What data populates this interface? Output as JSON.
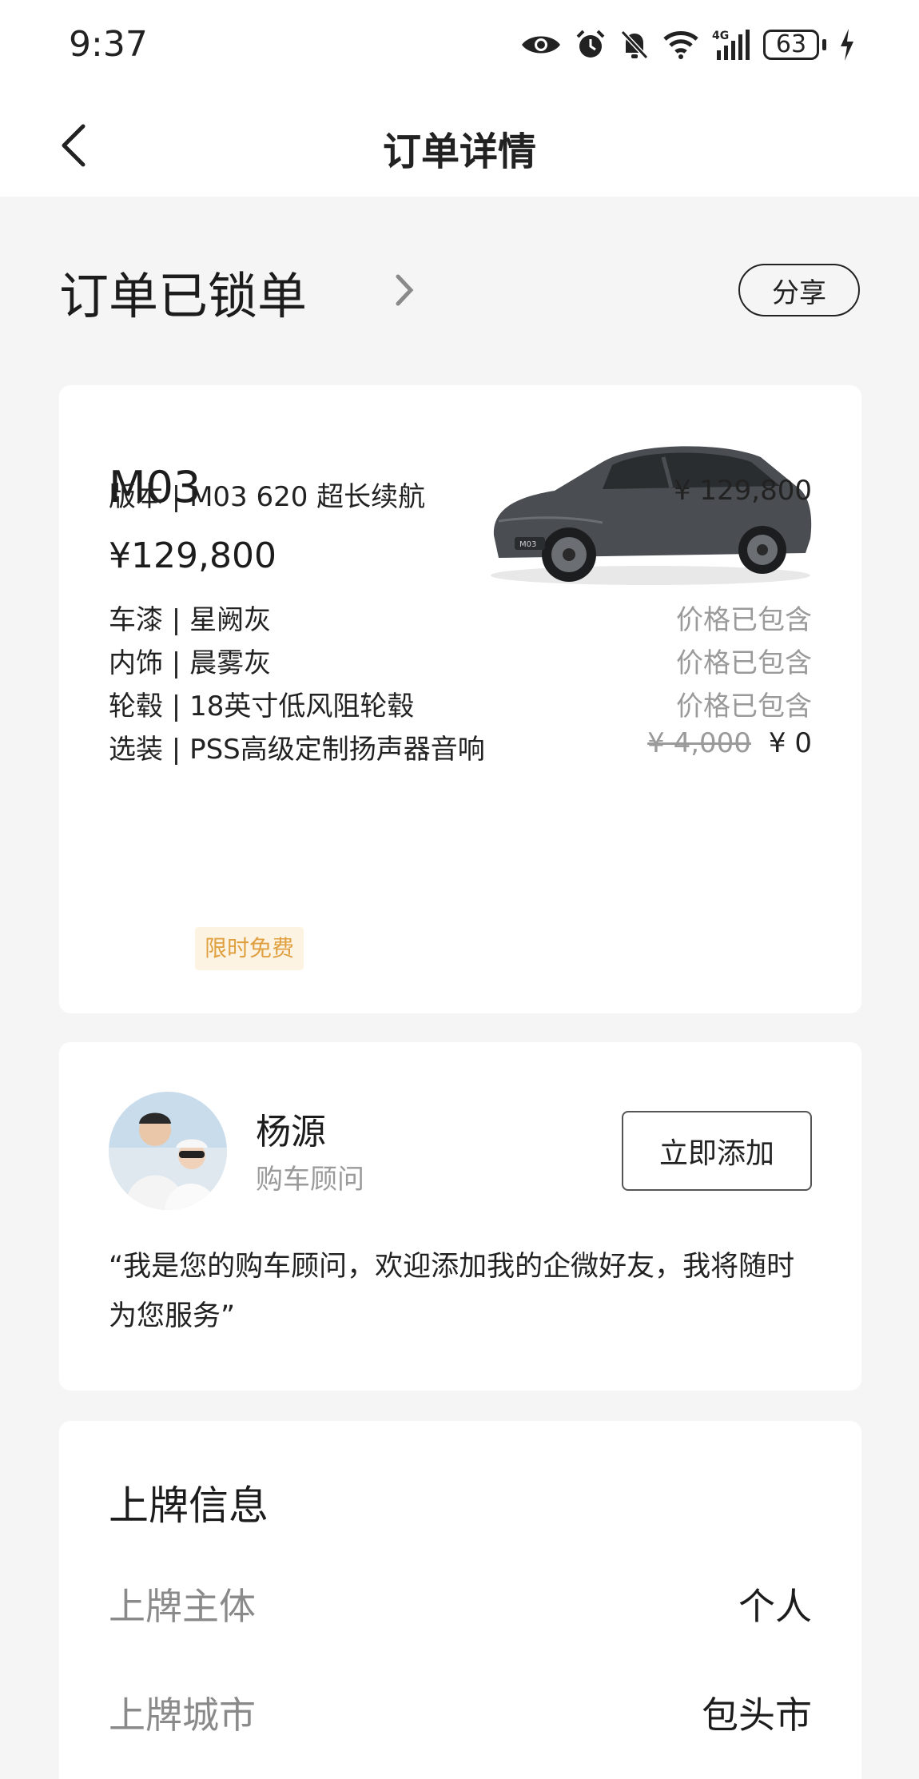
{
  "status_bar": {
    "time": "9:37",
    "battery": "63"
  },
  "nav": {
    "title": "订单详情"
  },
  "order": {
    "status": "订单已锁单",
    "share_label": "分享"
  },
  "car": {
    "model": "M03",
    "price": "¥129,800",
    "specs": [
      {
        "left": "版本 | M03 620 超长续航",
        "right": "¥ 129,800"
      },
      {
        "left": "车漆 | 星阙灰",
        "right": "价格已包含"
      },
      {
        "left": "内饰 | 晨雾灰",
        "right": "价格已包含"
      },
      {
        "left": "轮毂 | 18英寸低风阻轮毂",
        "right": "价格已包含"
      },
      {
        "left": "选装 | PSS高级定制扬声器音响",
        "strike": "¥ 4,000",
        "right": "¥ 0"
      }
    ],
    "tag": "限时免费",
    "badge_text": "M03"
  },
  "advisor": {
    "name": "杨源",
    "role": "购车顾问",
    "add_label": "立即添加",
    "quote": "“我是您的购车顾问，欢迎添加我的企微好友，我将随时为您服务”"
  },
  "plate": {
    "title": "上牌信息",
    "rows": [
      {
        "key": "上牌主体",
        "value": "个人"
      },
      {
        "key": "上牌城市",
        "value": "包头市"
      }
    ]
  },
  "colors": {
    "background": "#f5f5f6",
    "card": "#ffffff",
    "tag_bg": "#fdf3e3",
    "tag_text": "#e0a040",
    "muted": "#9a9a9a"
  }
}
